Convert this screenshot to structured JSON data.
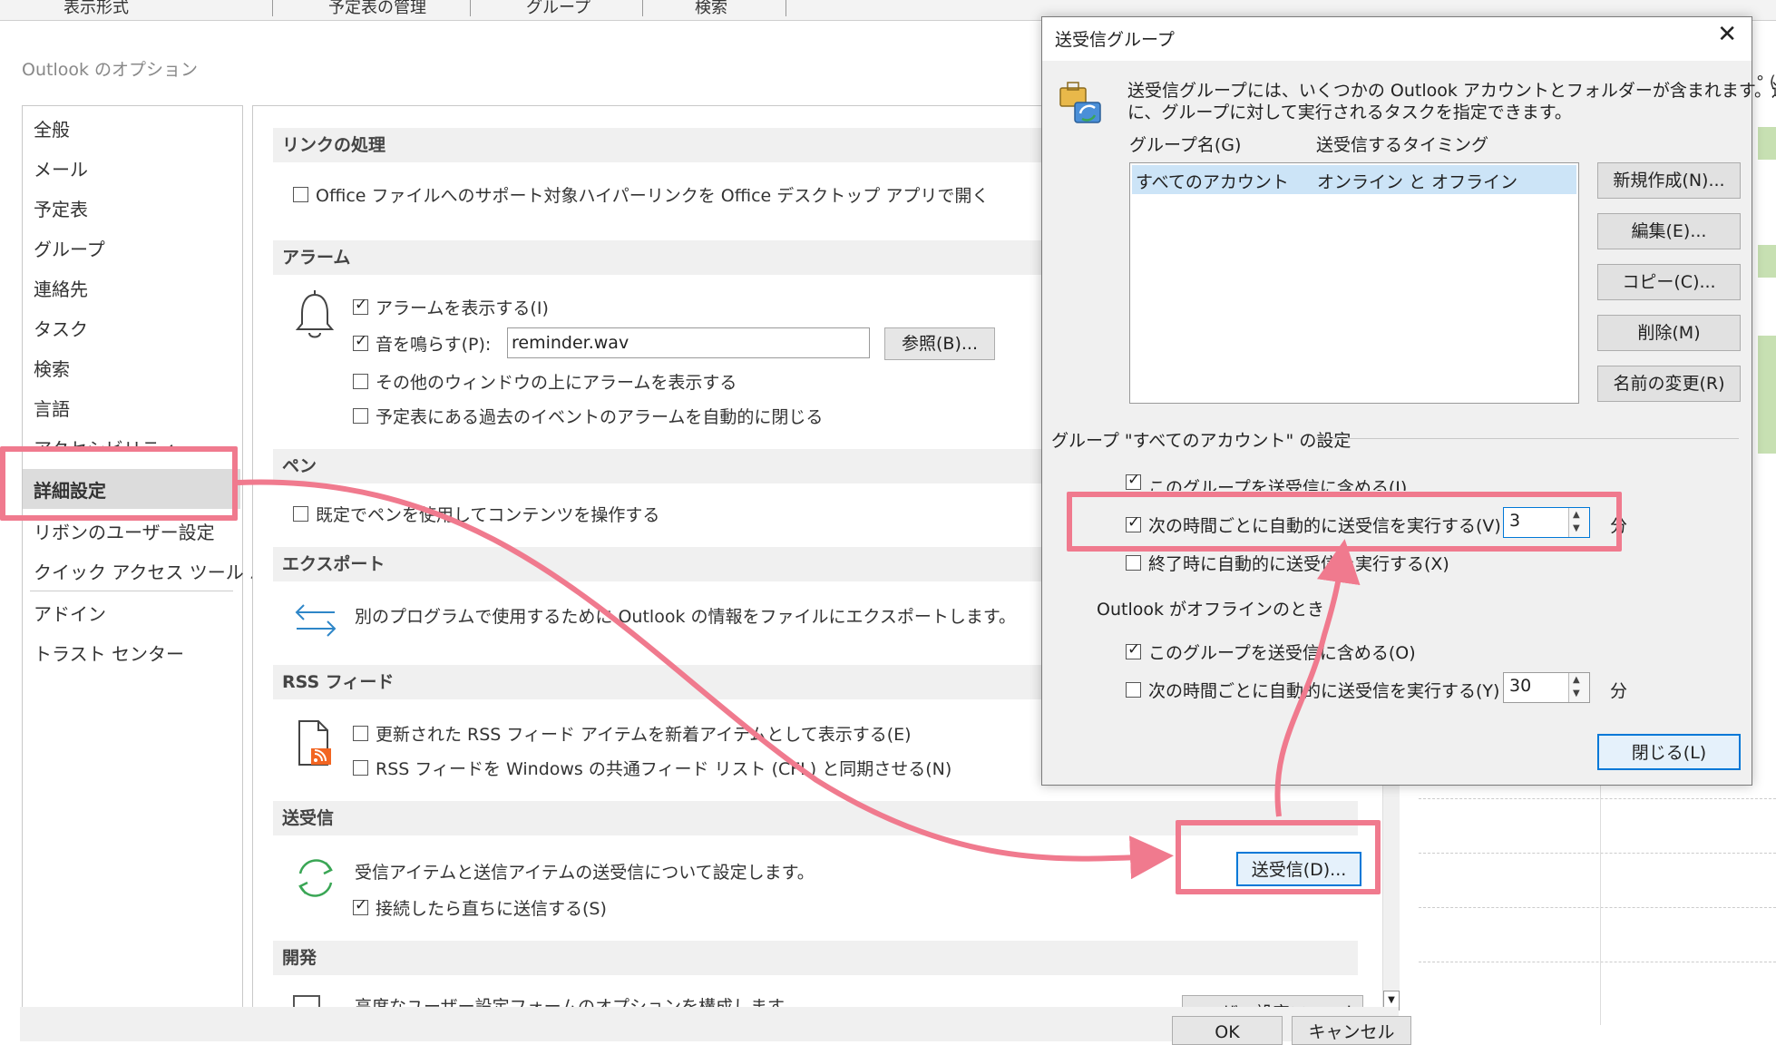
{
  "top_tabs": [
    "表示形式",
    "予定表の管理",
    "グループ",
    "検索"
  ],
  "options_window": {
    "title": "Outlook のオプション",
    "nav": [
      "全般",
      "メール",
      "予定表",
      "グループ",
      "連絡先",
      "タスク",
      "検索",
      "言語",
      "アクセシビリティ",
      "詳細設定",
      "リボンのユーザー設定",
      "クイック アクセス ツール バー",
      "アドイン",
      "トラスト センター"
    ],
    "selected_nav": "詳細設定",
    "sections": {
      "links": {
        "header": "リンクの処理",
        "option": "Office ファイルへのサポート対象ハイパーリンクを Office デスクトップ アプリで開く"
      },
      "alarm": {
        "header": "アラーム",
        "show_alarm": "アラームを表示する(I)",
        "play_sound": "音を鳴らす(P):",
        "sound_file": "reminder.wav",
        "browse": "参照(B)...",
        "on_top": "その他のウィンドウの上にアラームを表示する",
        "auto_close": "予定表にある過去のイベントのアラームを自動的に閉じる"
      },
      "pen": {
        "header": "ペン",
        "option": "既定でペンを使用してコンテンツを操作する"
      },
      "export": {
        "header": "エクスポート",
        "desc": "別のプログラムで使用するために Outlook の情報をファイルにエクスポートします。"
      },
      "rss": {
        "header": "RSS フィード",
        "opt1": "更新された RSS フィード アイテムを新着アイテムとして表示する(E)",
        "opt2": "RSS フィードを Windows の共通フィード リスト (CFL) と同期させる(N)"
      },
      "sendrecv": {
        "header": "送受信",
        "desc": "受信アイテムと送信アイテムの送受信について設定します。",
        "button": "送受信(D)...",
        "send_immediately": "接続したら直ちに送信する(S)"
      },
      "dev": {
        "header": "開発",
        "desc": "高度なユーザー設定フォームのオプションを構成します。",
        "button": "ユーザー設定フォーム(C)..."
      }
    },
    "ok": "OK",
    "cancel": "キャンセル"
  },
  "dialog": {
    "title": "送受信グループ",
    "description_line1": "送受信グループには、いくつかの Outlook アカウントとフォルダーが含まれます。送受信中",
    "description_line2": "に、グループに対して実行されるタスクを指定できます。",
    "col_group": "グループ名(G)",
    "col_timing": "送受信するタイミング",
    "list": [
      {
        "name": "すべてのアカウント",
        "timing": "オンライン と オフライン"
      }
    ],
    "buttons": {
      "new": "新規作成(N)...",
      "edit": "編集(E)...",
      "copy": "コピー(C)...",
      "delete": "削除(M)",
      "rename": "名前の変更(R)",
      "close": "閉じる(L)"
    },
    "group_settings": "グループ \"すべてのアカウント\" の設定",
    "online": {
      "include": "このグループを送受信に含める(I)",
      "auto": "次の時間ごとに自動的に送受信を実行する(V)",
      "interval": "3",
      "unit": "分",
      "on_exit": "終了時に自動的に送受信を実行する(X)"
    },
    "offline_label": "Outlook がオフラインのとき",
    "offline": {
      "include": "このグループを送受信に含める(O)",
      "auto": "次の時間ごとに自動的に送受信を実行する(Y)",
      "interval": "30",
      "unit": "分"
    }
  },
  "right_edge_text": "° ("
}
